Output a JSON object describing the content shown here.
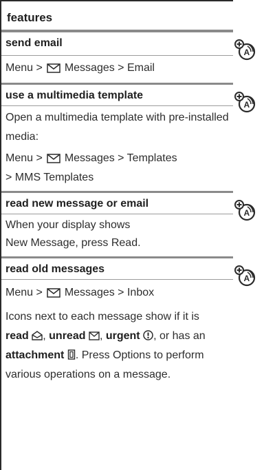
{
  "header": {
    "title": "features"
  },
  "sections": [
    {
      "title": "send email",
      "path": {
        "menu": "Menu >",
        "messages": "Messages > Email"
      }
    },
    {
      "title": "use a multimedia template",
      "desc": "Open a multimedia template with pre-installed media:",
      "path": {
        "menu": "Menu >",
        "messages": "Messages > Templates",
        "cont": "> MMS Templates"
      }
    },
    {
      "title": "read new message or email",
      "desc_a": "When your display shows",
      "desc_b": "New Message, press Read."
    },
    {
      "title": "read old messages",
      "path": {
        "menu": "Menu >",
        "messages": "Messages > Inbox"
      },
      "p1": "Icons next to each message show if it is",
      "read_label": "read",
      "unread_label": "unread",
      "urgent_label": "urgent",
      "attachment_label": "attachment",
      "or_has_an": ", or has an",
      "press_options": ". Press Options to perform",
      "p3": "various operations on a message."
    }
  ],
  "icons": {
    "network": "network-feature-icon",
    "envelope": "messages-envelope-icon"
  }
}
